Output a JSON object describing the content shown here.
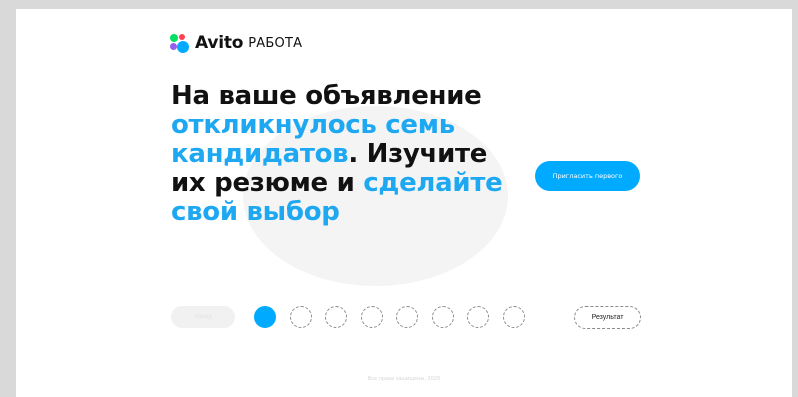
{
  "logo": {
    "brand": "Avito",
    "sub": "РАБОТА"
  },
  "headline": {
    "part1": "На ваше объявление",
    "part2": "откликнулось семь кандидатов",
    "part3": ". Изучите их резюме и ",
    "part4": "сделайте свой выбор"
  },
  "invite_button": "Пригласить первого",
  "prev_button": "Назад",
  "steps": {
    "total": 8,
    "active_index": 0
  },
  "result_button": "Результат",
  "footer": "Все права защищены, 2020",
  "colors": {
    "accent": "#00AAFF",
    "headline_blue": "#1EA8F2",
    "text": "#111111"
  }
}
